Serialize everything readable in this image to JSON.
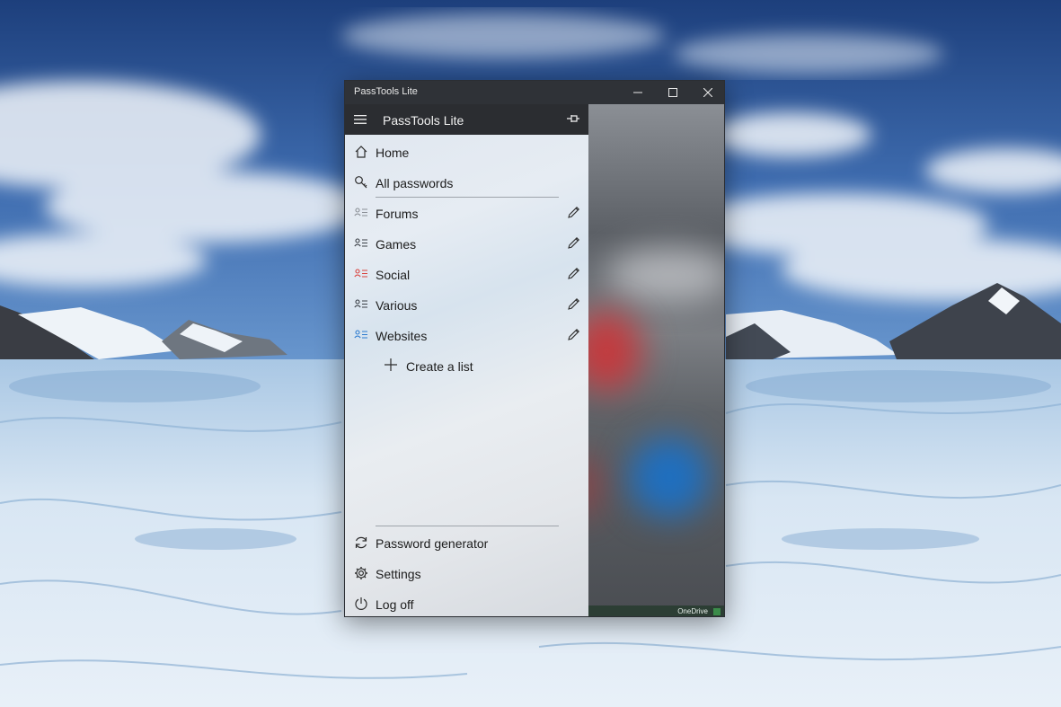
{
  "window": {
    "title": "PassTools Lite",
    "controls": [
      "minimize-icon",
      "maximize-icon",
      "close-icon"
    ]
  },
  "pane": {
    "app_name": "PassTools Lite",
    "top_items": [
      {
        "label": "Home",
        "icon": "home-icon"
      },
      {
        "label": "All passwords",
        "icon": "key-icon"
      }
    ],
    "lists": [
      {
        "label": "Forums",
        "icon_color": "#8a8f96"
      },
      {
        "label": "Games",
        "icon_color": "#3a3f46"
      },
      {
        "label": "Social",
        "icon_color": "#d9443f"
      },
      {
        "label": "Various",
        "icon_color": "#3a3f46"
      },
      {
        "label": "Websites",
        "icon_color": "#2f7dd0"
      }
    ],
    "create_label": "Create a list",
    "bottom_items": [
      {
        "label": "Password generator",
        "icon": "refresh-icon"
      },
      {
        "label": "Settings",
        "icon": "gear-icon"
      },
      {
        "label": "Log off",
        "icon": "power-icon"
      }
    ]
  },
  "status": {
    "sync_label": "OneDrive",
    "sync_color": "#3b8c4a"
  }
}
